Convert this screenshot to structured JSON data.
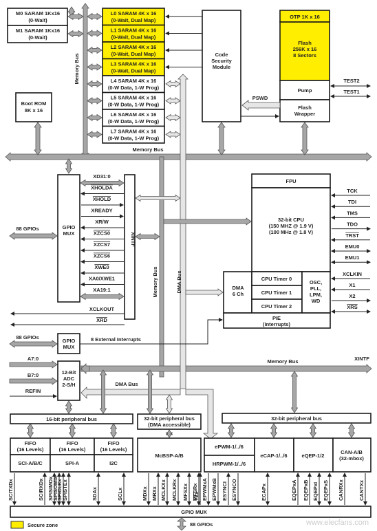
{
  "memory": {
    "m0": [
      "M0 SARAM 1Kx16",
      "(0-Wait)"
    ],
    "m1": [
      "M1 SARAM 1Kx16",
      "(0-Wait)"
    ],
    "boot_rom": [
      "Boot ROM",
      "8K x 16"
    ],
    "l_blocks": [
      {
        "line1": "L0 SARAM 4K x 16",
        "line2": "(0-Wait, Dual Map)",
        "secure": true
      },
      {
        "line1": "L1 SARAM 4K x 16",
        "line2": "(0-Wait, Dual Map)",
        "secure": true
      },
      {
        "line1": "L2 SARAM 4K x 16",
        "line2": "(0-Wait, Dual Map)",
        "secure": true
      },
      {
        "line1": "L3 SARAM 4K x 16",
        "line2": "(0-Wait, Dual Map)",
        "secure": true
      },
      {
        "line1": "L4 SARAM 4K x 16",
        "line2": "(0-W Data, 1-W Prog)",
        "secure": false
      },
      {
        "line1": "L5 SARAM 4K x 16",
        "line2": "(0-W Data, 1-W Prog)",
        "secure": false
      },
      {
        "line1": "L6 SARAM 4K x 16",
        "line2": "(0-W Data, 1-W Prog)",
        "secure": false
      },
      {
        "line1": "L7 SARAM 4K x 16",
        "line2": "(0-W Data, 1-W Prog)",
        "secure": false
      }
    ],
    "csm": [
      "Code",
      "Security",
      "Module"
    ],
    "otp": "OTP 1K x 16",
    "flash": [
      "Flash",
      "256K x 16",
      "8 Sectors"
    ],
    "pump": "Pump",
    "flash_wrapper": [
      "Flash",
      "Wrapper"
    ],
    "pswd": "PSWD",
    "test2": "TEST2",
    "test1": "TEST1"
  },
  "buses": {
    "memory_bus": "Memory Bus",
    "dma_bus": "DMA Bus",
    "xintf": "XINTF",
    "bus16": "16-bit peripheral bus",
    "bus32dma": [
      "32-bit peripheral bus",
      "(DMA accessible)"
    ],
    "bus32": "32-bit peripheral bus"
  },
  "xintf_block": {
    "gpio_mux": [
      "GPIO",
      "MUX"
    ],
    "gpios": "88 GPIOs",
    "label": "XINTF",
    "signals": [
      {
        "name": "XD31:0",
        "overline": false,
        "dir": "bidir-bus"
      },
      {
        "name": "XHOLDA",
        "overline": true,
        "dir": "left"
      },
      {
        "name": "XHOLD",
        "overline": true,
        "dir": "right"
      },
      {
        "name": "XREADY",
        "overline": false,
        "dir": "right"
      },
      {
        "name": "XR/W",
        "overline": false,
        "dir": "left"
      },
      {
        "name": "XZCS0",
        "overline": true,
        "dir": "left"
      },
      {
        "name": "XZCS7",
        "overline": true,
        "dir": "left"
      },
      {
        "name": "XZCS6",
        "overline": true,
        "dir": "left"
      },
      {
        "name": "XWE0",
        "overline": true,
        "dir": "left"
      },
      {
        "name": "XA0/XWE1",
        "overline": false,
        "dir": "left"
      },
      {
        "name": "XA19:1",
        "overline": false,
        "dir": "bidir-bus"
      }
    ],
    "xclkout": "XCLKOUT",
    "xrd": "XRD"
  },
  "cpu": {
    "fpu": "FPU",
    "core": [
      "32-bit CPU",
      "(150 MHZ @ 1.9 V)",
      "(100 MHz @ 1.8 V)"
    ],
    "dma": [
      "DMA",
      "6 Ch"
    ],
    "timers": [
      "CPU Timer 0",
      "CPU Timer 1",
      "CPU Timer 2"
    ],
    "osc": [
      "OSC,",
      "PLL,",
      "LPM,",
      "WD"
    ],
    "pie": [
      "PIE",
      "(Interrupts)"
    ],
    "pins": [
      {
        "name": "TCK",
        "overline": false,
        "dir": "in"
      },
      {
        "name": "TDI",
        "overline": false,
        "dir": "in"
      },
      {
        "name": "TMS",
        "overline": false,
        "dir": "in"
      },
      {
        "name": "TDO",
        "overline": false,
        "dir": "out"
      },
      {
        "name": "TRST",
        "overline": true,
        "dir": "in"
      },
      {
        "name": "EMU0",
        "overline": false,
        "dir": "bidir"
      },
      {
        "name": "EMU1",
        "overline": false,
        "dir": "bidir"
      },
      {
        "name": "XCLKIN",
        "overline": false,
        "dir": "in"
      },
      {
        "name": "X1",
        "overline": false,
        "dir": "in"
      },
      {
        "name": "X2",
        "overline": false,
        "dir": "out"
      },
      {
        "name": "XRS",
        "overline": true,
        "dir": "bidir"
      }
    ]
  },
  "lower": {
    "gpio_mux2": [
      "GPIO",
      "MUX"
    ],
    "gpios2": "88 GPIOs",
    "ext_int": "8 External Interrupts",
    "a70": "A7:0",
    "b70": "B7:0",
    "refin": "REFIN",
    "adc": [
      "12-Bit",
      "ADC",
      "2-S/H"
    ]
  },
  "peripherals": {
    "fifo": [
      "FIFO",
      "(16 Levels)"
    ],
    "sci": "SCI-A/B/C",
    "spi": "SPI-A",
    "i2c": "I2C",
    "mcbsp": "McBSP-A/B",
    "epwm": "ePWM-1/../6",
    "hrpwm": "HRPWM-1/../6",
    "ecap": "eCAP-1/../6",
    "eqep": "eQEP-1/2",
    "can": [
      "CAN-A/B",
      "(32-mbox)"
    ]
  },
  "pins_bottom": [
    {
      "name": "SCITXDx",
      "dir": "down"
    },
    {
      "name": "SCIRXDx",
      "dir": "up"
    },
    {
      "name": "SPISIMOx",
      "dir": "bidir"
    },
    {
      "name": "SPISOMIx",
      "dir": "bidir"
    },
    {
      "name": "SPICLKx",
      "dir": "bidir"
    },
    {
      "name": "SPISTEx",
      "dir": "bidir"
    },
    {
      "name": "SDAx",
      "dir": "bidir"
    },
    {
      "name": "SCLx",
      "dir": "bidir"
    },
    {
      "name": "MDXx",
      "dir": "down"
    },
    {
      "name": "MRXx",
      "dir": "up"
    },
    {
      "name": "MCLKXx",
      "dir": "bidir"
    },
    {
      "name": "MCLKRx",
      "dir": "bidir"
    },
    {
      "name": "MFSXx",
      "dir": "bidir"
    },
    {
      "name": "MFSRx",
      "dir": "bidir"
    },
    {
      "name": "TZx",
      "dir": "up",
      "overline": true
    },
    {
      "name": "EPWMxA",
      "dir": "down"
    },
    {
      "name": "EPWMxB",
      "dir": "down"
    },
    {
      "name": "ESYNCI",
      "dir": "up"
    },
    {
      "name": "ESYNCO",
      "dir": "down"
    },
    {
      "name": "ECAPx",
      "dir": "bidir"
    },
    {
      "name": "EQEPxA",
      "dir": "up"
    },
    {
      "name": "EQEPxB",
      "dir": "up"
    },
    {
      "name": "EQEPxI",
      "dir": "bidir"
    },
    {
      "name": "EQEPxS",
      "dir": "bidir"
    },
    {
      "name": "CANRXx",
      "dir": "up"
    },
    {
      "name": "CANTXx",
      "dir": "down"
    }
  ],
  "gpio_mux_bottom": "GPIO MUX",
  "gpios_bottom": "88 GPIOs",
  "legend": {
    "label": "Secure zone",
    "color": "#ffee00"
  },
  "watermark": "www.elecfans.com",
  "colors": {
    "secure": "#ffee00",
    "memory_bus": "#a6a6a6",
    "dma_bus": "#e6e6e6"
  }
}
